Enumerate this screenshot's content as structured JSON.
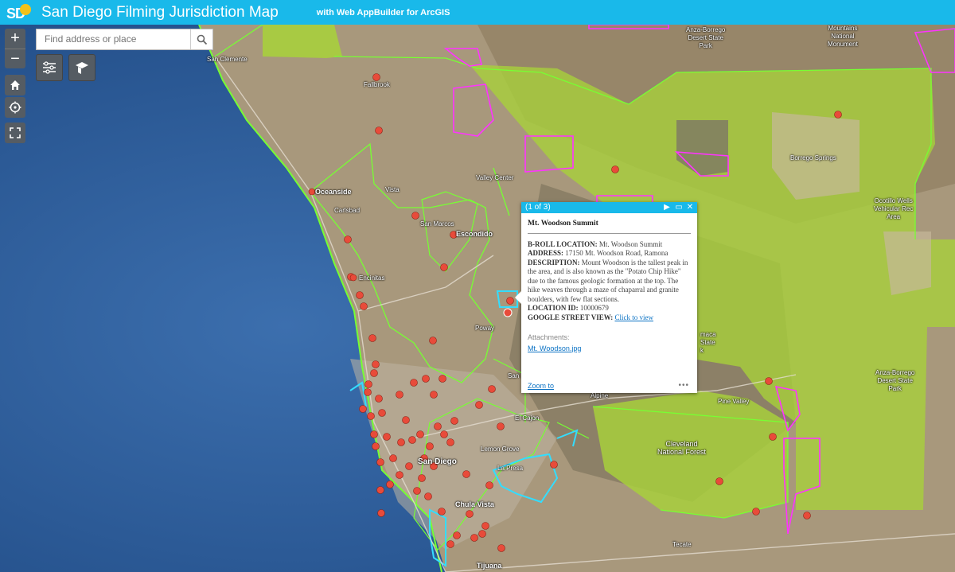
{
  "header": {
    "title": "San Diego Filming Jurisdiction Map",
    "subtitle": "with Web AppBuilder for ArcGIS",
    "logo_text": "SD"
  },
  "search": {
    "placeholder": "Find address or place"
  },
  "controls": {
    "zoom_in": "+",
    "zoom_out": "−",
    "icons": [
      "home-icon",
      "locate-icon",
      "fullscreen-icon",
      "layer-list-icon",
      "basemap-gallery-icon"
    ]
  },
  "colors": {
    "header": "#19b9ea",
    "jurisdiction_city": "#77ff33",
    "jurisdiction_federal": "#ff33ff",
    "jurisdiction_port": "#33ddff",
    "park_fill": "#a8d23a",
    "marker": "#e84b3a"
  },
  "places": {
    "anza_borrego_n": "Anza-Borrego\nDesert State\nPark",
    "santa_rosa": "Mountains\nNational\nMonument",
    "san_clemente": "San Clemente",
    "fallbrook": "Fallbrook",
    "valley_center": "Valley Center",
    "borrego_springs": "Borrego Springs",
    "ocotillo_wells": "Ocotillo Wells\nVehicular Rec\nArea",
    "oceanside": "Oceanside",
    "vista": "Vista",
    "carlsbad": "Carlsbad",
    "san_marcos": "San Marcos",
    "escondido": "Escondido",
    "encinitas": "Encinitas",
    "poway": "Poway",
    "ramona_park": "maca\nState\nk",
    "anza_borrego_s": "Anza-Borrego\nDesert State\nPark",
    "alpine": "Alpine",
    "pine_valley": "Pine Valley",
    "el_cajon": "El Cajon",
    "lemon_grove": "Lemon Grove",
    "la_presa": "La Presa",
    "cleveland": "Cleveland\nNational Forest",
    "san_diego": "San Diego",
    "chula_vista": "Chula Vista",
    "tecate": "Tecate",
    "tijuana": "Tijuana",
    "santee": "San"
  },
  "popup": {
    "counter": "(1 of 3)",
    "title": "Mt. Woodson Summit",
    "broll_label": "B-ROLL LOCATION:",
    "broll_value": "Mt. Woodson Summit",
    "address_label": "ADDRESS:",
    "address_value": "17150 Mt. Woodson Road, Ramona",
    "description_label": "DESCRIPTION:",
    "description_value": "Mount Woodson is the tallest peak in the area, and is also known as the \"Potato Chip Hike\" due to the famous geologic formation at the top. The hike weaves through a maze of chaparral and granite boulders, with few flat sections.",
    "location_id_label": "LOCATION ID:",
    "location_id_value": "10000679",
    "street_view_label": "GOOGLE STREET VIEW:",
    "street_view_link": "Click to view",
    "attachments_label": "Attachments:",
    "attachment_file": "Mt. Woodson.jpg",
    "zoom_link": "Zoom to",
    "more": "•••"
  }
}
